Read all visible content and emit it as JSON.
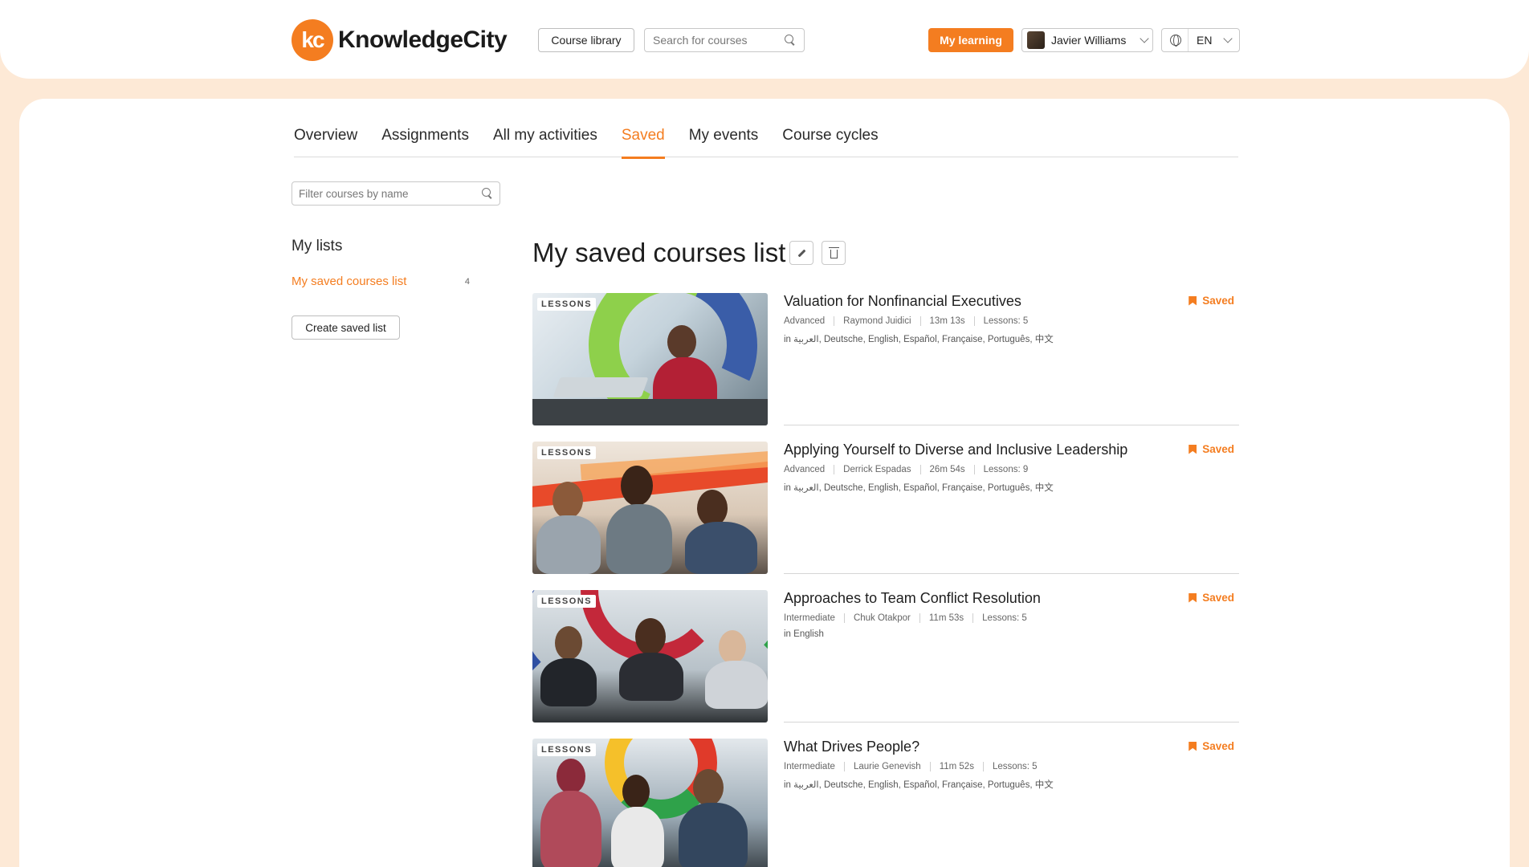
{
  "header": {
    "logo_mark": "kc",
    "logo_text": "KnowledgeCity",
    "course_library": "Course library",
    "search_placeholder": "Search for courses",
    "my_learning": "My learning",
    "user_name": "Javier Williams",
    "language": "EN"
  },
  "tabs": [
    {
      "label": "Overview",
      "active": false
    },
    {
      "label": "Assignments",
      "active": false
    },
    {
      "label": "All my activities",
      "active": false
    },
    {
      "label": "Saved",
      "active": true
    },
    {
      "label": "My events",
      "active": false
    },
    {
      "label": "Course cycles",
      "active": false
    }
  ],
  "filter_placeholder": "Filter courses by name",
  "sidebar": {
    "title": "My lists",
    "items": [
      {
        "label": "My saved courses list",
        "count": "4"
      }
    ],
    "create_button": "Create saved list"
  },
  "list": {
    "title": "My saved courses list",
    "courses": [
      {
        "badge": "LESSONS",
        "title": "Valuation for Nonfinancial Executives",
        "level": "Advanced",
        "author": "Raymond Juidici",
        "duration": "13m 13s",
        "lessons": "Lessons: 5",
        "languages": "in العربية, Deutsche, English, Español, Française, Português, 中文",
        "saved_label": "Saved"
      },
      {
        "badge": "LESSONS",
        "title": "Applying Yourself to Diverse and Inclusive Leadership",
        "level": "Advanced",
        "author": "Derrick Espadas",
        "duration": "26m 54s",
        "lessons": "Lessons: 9",
        "languages": "in العربية, Deutsche, English, Español, Française, Português, 中文",
        "saved_label": "Saved"
      },
      {
        "badge": "LESSONS",
        "title": "Approaches to Team Conflict Resolution",
        "level": "Intermediate",
        "author": "Chuk Otakpor",
        "duration": "11m 53s",
        "lessons": "Lessons: 5",
        "languages": "in English",
        "saved_label": "Saved"
      },
      {
        "badge": "LESSONS",
        "title": "What Drives People?",
        "level": "Intermediate",
        "author": "Laurie Genevish",
        "duration": "11m 52s",
        "lessons": "Lessons: 5",
        "languages": "in العربية, Deutsche, English, Español, Française, Português, 中文",
        "saved_label": "Saved"
      }
    ]
  },
  "colors": {
    "accent": "#f47d20",
    "page_background": "#fde9d6"
  }
}
